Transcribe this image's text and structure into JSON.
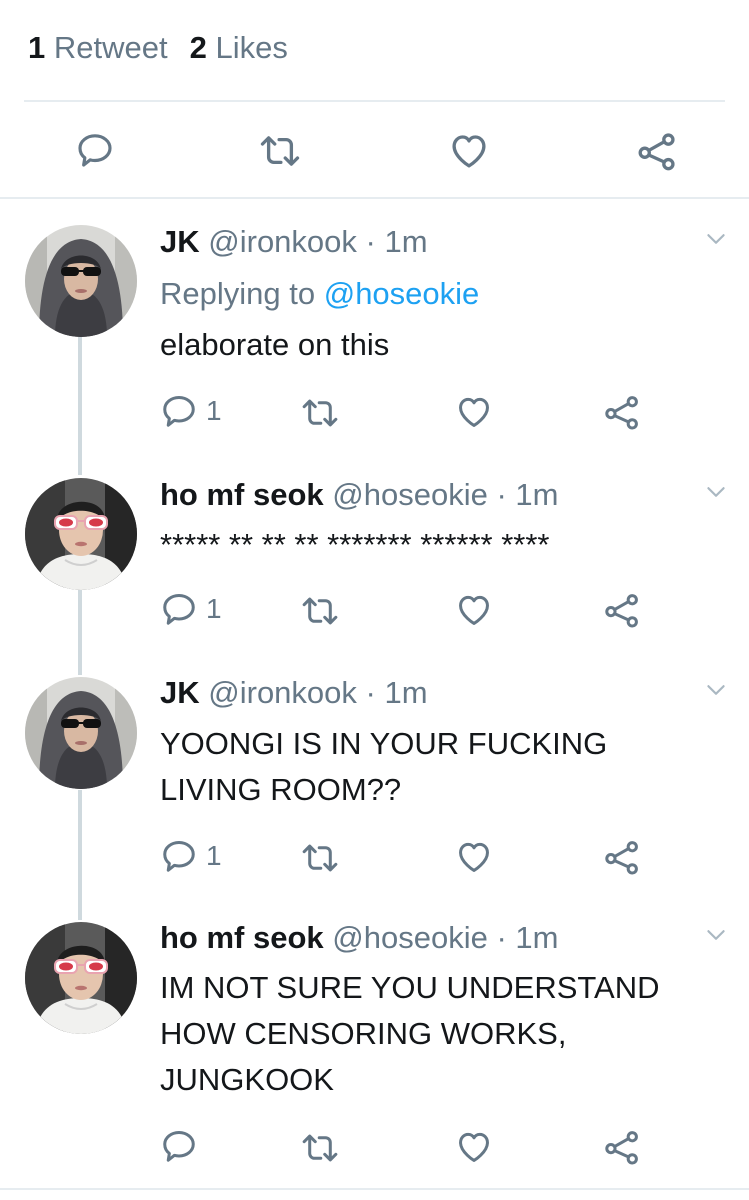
{
  "stats": {
    "retweet_count": "1",
    "retweet_label": "Retweet",
    "like_count": "2",
    "like_label": "Likes"
  },
  "tweets": [
    {
      "name": "JK",
      "handle": "@ironkook",
      "sep": "·",
      "time": "1m",
      "replying_label": "Replying to",
      "replying_handle": "@hoseokie",
      "text": "elaborate on this",
      "reply_count": "1"
    },
    {
      "name": "ho mf seok",
      "handle": "@hoseokie",
      "sep": "·",
      "time": "1m",
      "text": "***** ** ** ** ******* ****** ****",
      "reply_count": "1"
    },
    {
      "name": "JK",
      "handle": "@ironkook",
      "sep": "·",
      "time": "1m",
      "text": "YOONGI IS IN YOUR FUCKING LIVING ROOM??",
      "reply_count": "1"
    },
    {
      "name": "ho mf seok",
      "handle": "@hoseokie",
      "sep": "·",
      "time": "1m",
      "text": "IM NOT SURE YOU UNDERSTAND HOW CENSORING WORKS, JUNGKOOK",
      "reply_count": ""
    }
  ],
  "icons": {
    "reply": "reply-icon",
    "retweet": "retweet-icon",
    "like": "heart-icon",
    "share": "share-icon",
    "more": "chevron-down-icon"
  },
  "colors": {
    "text": "#14171a",
    "muted": "#657786",
    "link": "#1da1f2",
    "divider": "#e6ecf0",
    "thread": "#cfd9de"
  }
}
